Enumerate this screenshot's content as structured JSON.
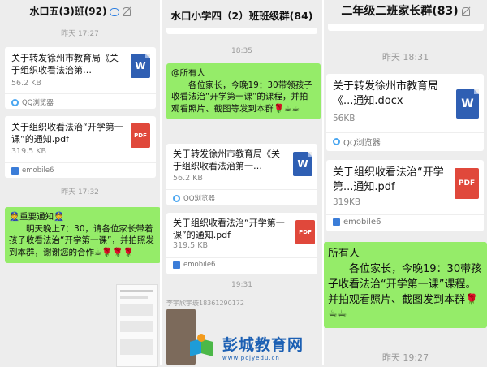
{
  "panel1": {
    "title": "水口五(3)班(92)",
    "time1": "昨天 17:27",
    "file1": {
      "title": "关于转发徐州市教育局《关于组织收看法治第…",
      "size": "56.2 KB",
      "source": "QQ浏览器",
      "icon": "W"
    },
    "file2": {
      "title": "关于组织收看法治“开学第一课”的通知.pdf",
      "size": "319.5 KB",
      "source": "emobile6",
      "icon": "PDF"
    },
    "time2": "昨天 17:32",
    "msg": {
      "line1": "👮重要通知👮",
      "line2": "明天晚上7：30，请各位家长带着孩子收看法治“开学第一课”，并拍照发到本群，谢谢您的合作☕🌹🌹🌹"
    }
  },
  "panel2": {
    "title": "水口小学四（2）班班级群(84)",
    "time1": "18:35",
    "msg": {
      "line1": "@所有人",
      "line2": "各位家长，今晚19：30带领孩子收看法治“开学第一课”的课程，并拍观看照片、截图等发到本群🌹☕☕"
    },
    "file1": {
      "title": "关于转发徐州市教育局《关于组织收看法治第一…",
      "size": "56.2 KB",
      "source": "QQ浏览器",
      "icon": "W"
    },
    "file2": {
      "title": "关于组织收看法治“开学第一课”的通知.pdf",
      "size": "319.5 KB",
      "source": "emobile6",
      "icon": "PDF"
    },
    "time2": "19:31",
    "sender": "李宇欣宇璇18361290172"
  },
  "panel3": {
    "title": "二年级二班家长群(83)",
    "time1": "昨天 18:31",
    "file1": {
      "title": "关于转发徐州市教育局《...通知.docx",
      "size": "56KB",
      "source": "QQ浏览器",
      "icon": "W"
    },
    "file2": {
      "title": "关于组织收看法治“开学第...通知.pdf",
      "size": "319KB",
      "source": "emobile6",
      "icon": "PDF"
    },
    "msg": {
      "line1": "所有人",
      "line2": "各位家长，今晚19：30带孩子收看法治“开学第一课”课程。并拍观看照片、截图发到本群🌹☕☕"
    },
    "time2": "昨天 19:27"
  },
  "watermark": {
    "name": "彭城教育网",
    "url": "www.pcjyedu.cn"
  },
  "colors": {
    "bubble": "#95ec69",
    "word": "#2f5fb3",
    "pdf": "#e0483b",
    "background": "#ededed"
  }
}
